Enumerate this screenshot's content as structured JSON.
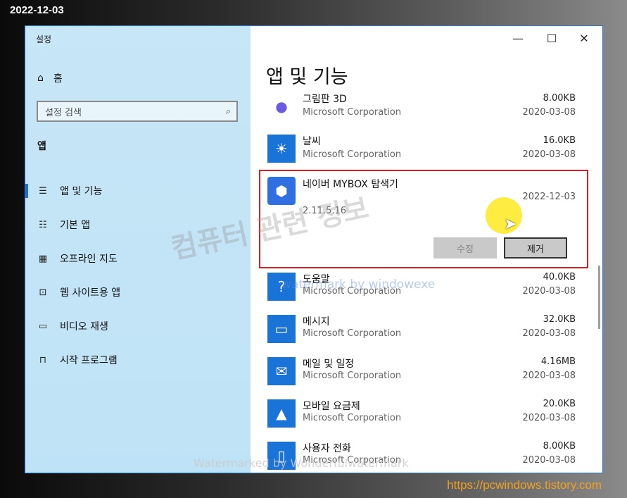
{
  "date_stamp": "2022-12-03",
  "site_stamp": "https://pcwindows.tistory.com",
  "window": {
    "title": "설정",
    "controls": {
      "minimize": "—",
      "maximize": "☐",
      "close": "✕"
    }
  },
  "sidebar": {
    "home_label": "홈",
    "search_placeholder": "설정 검색",
    "section_label": "앱",
    "items": [
      {
        "label": "앱 및 기능",
        "icon": "list-icon"
      },
      {
        "label": "기본 앱",
        "icon": "default-apps-icon"
      },
      {
        "label": "오프라인 지도",
        "icon": "map-icon"
      },
      {
        "label": "웹 사이트용 앱",
        "icon": "web-app-icon"
      },
      {
        "label": "비디오 재생",
        "icon": "video-icon"
      },
      {
        "label": "시작 프로그램",
        "icon": "startup-icon"
      }
    ]
  },
  "main": {
    "title": "앱 및 기능",
    "apps": [
      {
        "name": "그림판 3D",
        "publisher": "Microsoft Corporation",
        "size": "8.00KB",
        "date": "2020-03-08",
        "icon": "paint3d-icon"
      },
      {
        "name": "날씨",
        "publisher": "Microsoft Corporation",
        "size": "16.0KB",
        "date": "2020-03-08",
        "icon": "weather-icon"
      }
    ],
    "selected_app": {
      "name": "네이버 MYBOX 탐색기",
      "date": "2022-12-03",
      "version": "2.11.5.16",
      "modify_label": "수정",
      "remove_label": "제거",
      "icon": "mybox-icon"
    },
    "apps_after": [
      {
        "name": "도움말",
        "publisher": "Microsoft Corporation",
        "size": "40.0KB",
        "date": "2020-03-08",
        "icon": "help-icon"
      },
      {
        "name": "메시지",
        "publisher": "Microsoft Corporation",
        "size": "32.0KB",
        "date": "2020-03-08",
        "icon": "message-icon"
      },
      {
        "name": "메일 및 일정",
        "publisher": "Microsoft Corporation",
        "size": "4.16MB",
        "date": "2020-03-08",
        "icon": "mail-icon"
      },
      {
        "name": "모바일 요금제",
        "publisher": "Microsoft Corporation",
        "size": "20.0KB",
        "date": "2020-03-08",
        "icon": "mobile-plan-icon"
      },
      {
        "name": "사용자 전화",
        "publisher": "Microsoft Corporation",
        "size": "8.00KB",
        "date": "2020-03-08",
        "icon": "phone-icon"
      }
    ]
  },
  "watermarks": {
    "big": "컴퓨터 관련 정보",
    "blue": "watermark by windowexe",
    "bottom": "Watermarked by Wonderfulwatermark"
  },
  "colors": {
    "accent": "#1a73d6",
    "highlight_border": "#d42020",
    "sidebar_bg": "#c7e6f7"
  }
}
